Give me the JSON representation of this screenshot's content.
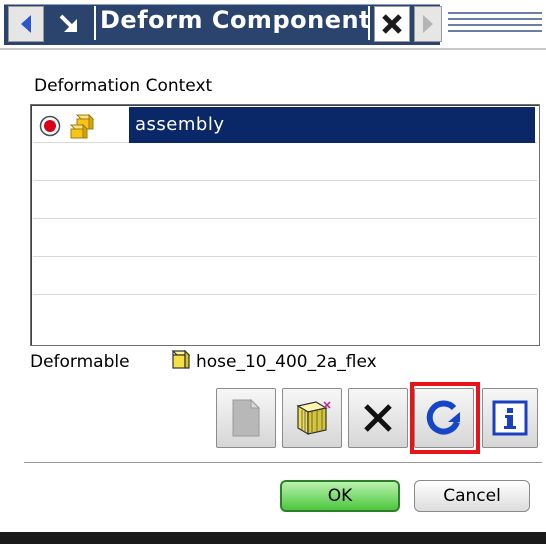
{
  "dialog": {
    "title": "Deform Component"
  },
  "section": {
    "context_label": "Deformation Context"
  },
  "list": {
    "items": [
      {
        "label": "assembly",
        "selected": true
      }
    ]
  },
  "deformable": {
    "label": "Deformable",
    "value": "hose_10_400_2a_flex"
  },
  "buttons": {
    "ok": "OK",
    "cancel": "Cancel"
  },
  "colors": {
    "title_bg": "#2a446e",
    "selection": "#0a2768",
    "highlight": "#e8141b",
    "ok_green": "#4cc63e",
    "refresh_blue": "#1646c8"
  }
}
